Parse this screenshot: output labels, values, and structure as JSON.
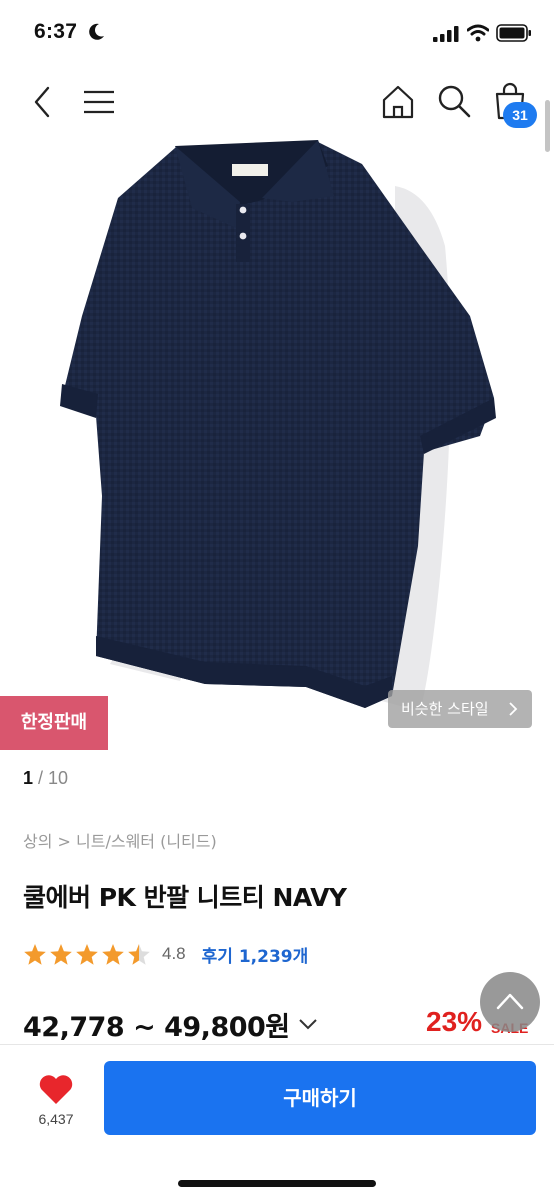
{
  "status_bar": {
    "time": "6:37"
  },
  "nav": {
    "cart_count": "31"
  },
  "product": {
    "limited_badge": "한정판매",
    "similar_style": "비슷한 스타일",
    "pager": {
      "current": "1",
      "separator": " / ",
      "total": "10"
    },
    "breadcrumb": "상의 > 니트/스웨터 (니티드)",
    "title": "쿨에버 PK 반팔 니트티 NAVY",
    "rating": {
      "value": "4.8",
      "stars": 4.5,
      "review_label": "후기 1,239개"
    },
    "price_range": "42,778 ~ 49,800원",
    "discount": "23%",
    "sale_label": "SALE",
    "garment_color": "#1c2742",
    "accent_color": "#e0211f"
  },
  "bottom_bar": {
    "like_count": "6,437",
    "buy_label": "구매하기",
    "buy_color": "#1a73f0"
  }
}
